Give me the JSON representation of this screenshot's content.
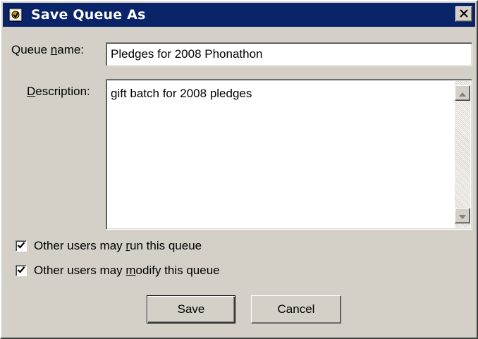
{
  "window": {
    "title": "Save Queue As"
  },
  "fields": {
    "queue_name": {
      "label_pre": "Queue ",
      "label_key": "n",
      "label_post": "ame:",
      "value": "Pledges for 2008 Phonathon"
    },
    "description": {
      "label_pre": "",
      "label_key": "D",
      "label_post": "escription:",
      "value": "gift batch for 2008 pledges"
    }
  },
  "options": {
    "run": {
      "pre": "Other users may ",
      "key": "r",
      "post": "un this queue",
      "checked": true
    },
    "modify": {
      "pre": "Other users may ",
      "key": "m",
      "post": "odify this queue",
      "checked": true
    }
  },
  "buttons": {
    "save": "Save",
    "cancel": "Cancel"
  },
  "colors": {
    "titlebar": "#0a246a",
    "face": "#d4d0c8"
  },
  "icons": {
    "app": "queue-app-icon",
    "close": "close-icon",
    "scroll_up": "scroll-up-arrow-icon",
    "scroll_down": "scroll-down-arrow-icon",
    "check": "checkmark-icon"
  }
}
